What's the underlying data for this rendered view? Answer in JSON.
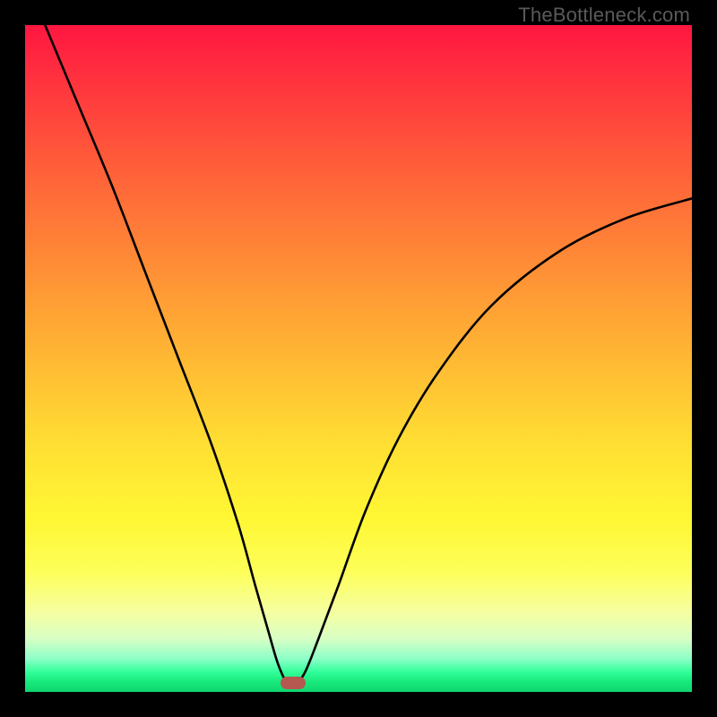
{
  "watermark": "TheBottleneck.com",
  "marker": {
    "x_frac": 0.402,
    "y_frac": 0.987
  },
  "chart_data": {
    "type": "line",
    "title": "",
    "xlabel": "",
    "ylabel": "",
    "xlim": [
      0,
      1
    ],
    "ylim": [
      0,
      1
    ],
    "series": [
      {
        "name": "bottleneck-curve",
        "x": [
          0.03,
          0.08,
          0.13,
          0.18,
          0.23,
          0.28,
          0.32,
          0.345,
          0.365,
          0.38,
          0.395,
          0.405,
          0.42,
          0.44,
          0.47,
          0.51,
          0.56,
          0.62,
          0.7,
          0.8,
          0.9,
          1.0
        ],
        "y": [
          1.0,
          0.88,
          0.76,
          0.63,
          0.5,
          0.37,
          0.25,
          0.16,
          0.09,
          0.04,
          0.01,
          0.01,
          0.03,
          0.08,
          0.16,
          0.27,
          0.38,
          0.48,
          0.58,
          0.66,
          0.71,
          0.74
        ]
      }
    ],
    "background_gradient": {
      "stops": [
        {
          "pos": 0.0,
          "color": "#ff163f"
        },
        {
          "pos": 0.2,
          "color": "#ff5a3a"
        },
        {
          "pos": 0.5,
          "color": "#ffb833"
        },
        {
          "pos": 0.74,
          "color": "#fff734"
        },
        {
          "pos": 0.88,
          "color": "#f6ffa1"
        },
        {
          "pos": 0.97,
          "color": "#33ff9a"
        },
        {
          "pos": 1.0,
          "color": "#0fd66f"
        }
      ]
    },
    "marker": {
      "x": 0.402,
      "y": 0.013,
      "color": "#b5584f"
    }
  }
}
